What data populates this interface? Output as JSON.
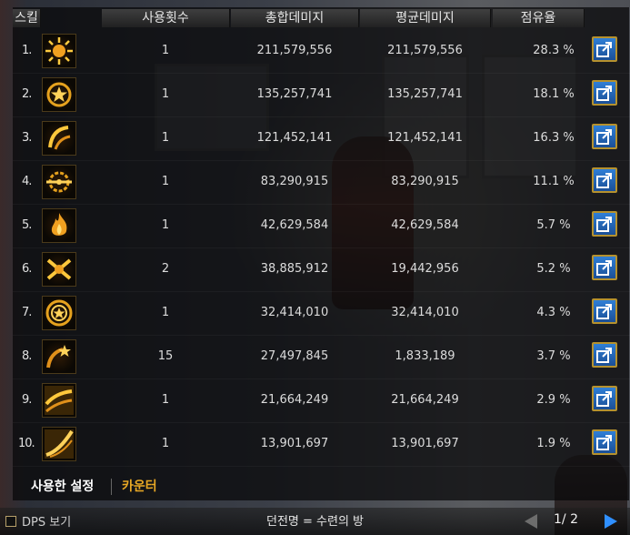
{
  "headers": {
    "skill": "스킬",
    "uses": "사용횟수",
    "total_damage": "총합데미지",
    "avg_damage": "평균데미지",
    "share": "점유율"
  },
  "rows": [
    {
      "rank": "1.",
      "icon": "sun-burst-icon",
      "uses": "1",
      "total": "211,579,556",
      "average": "211,579,556",
      "share": "28.3 %"
    },
    {
      "rank": "2.",
      "icon": "star-ring-icon",
      "uses": "1",
      "total": "135,257,741",
      "average": "135,257,741",
      "share": "18.1 %"
    },
    {
      "rank": "3.",
      "icon": "slash-arc-icon",
      "uses": "1",
      "total": "121,452,141",
      "average": "121,452,141",
      "share": "16.3 %"
    },
    {
      "rank": "4.",
      "icon": "sword-gear-icon",
      "uses": "1",
      "total": "83,290,915",
      "average": "83,290,915",
      "share": "11.1 %"
    },
    {
      "rank": "5.",
      "icon": "flame-icon",
      "uses": "1",
      "total": "42,629,584",
      "average": "42,629,584",
      "share": "5.7 %"
    },
    {
      "rank": "6.",
      "icon": "cross-slash-icon",
      "uses": "2",
      "total": "38,885,912",
      "average": "19,442,956",
      "share": "5.2 %"
    },
    {
      "rank": "7.",
      "icon": "star-circle-icon",
      "uses": "1",
      "total": "32,414,010",
      "average": "32,414,010",
      "share": "4.3 %"
    },
    {
      "rank": "8.",
      "icon": "star-swirl-icon",
      "uses": "15",
      "total": "27,497,845",
      "average": "1,833,189",
      "share": "3.7 %"
    },
    {
      "rank": "9.",
      "icon": "wave-slash-icon",
      "uses": "1",
      "total": "21,664,249",
      "average": "21,664,249",
      "share": "2.9 %"
    },
    {
      "rank": "10.",
      "icon": "swoosh-icon",
      "uses": "1",
      "total": "13,901,697",
      "average": "13,901,697",
      "share": "1.9 %"
    }
  ],
  "tabs": {
    "used_settings": "사용한 설정",
    "counter": "카운터"
  },
  "bottom": {
    "dps_label": "DPS 보기",
    "dungeon": "던전명 = 수련의 방",
    "page": "1/ 2"
  },
  "colors": {
    "tab_active": "#ffffff",
    "tab_counter": "#e8a825",
    "share_button": "#2f7fd6",
    "share_button_border": "#b5912e",
    "next_arrow": "#2f8fff"
  }
}
